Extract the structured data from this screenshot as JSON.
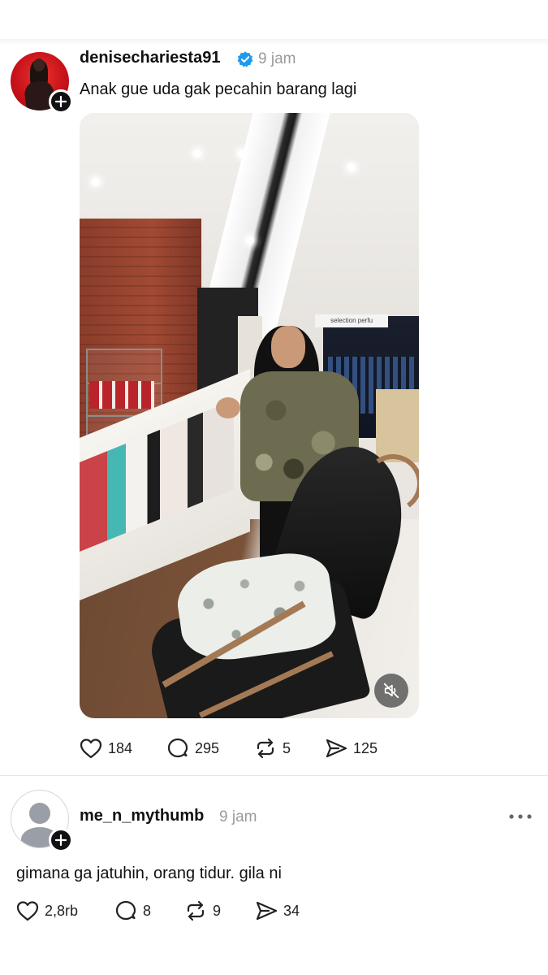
{
  "post": {
    "username": "denisechariesta91",
    "time": "9 jam",
    "text": "Anak gue uda gak pecahin barang lagi",
    "video_sign_text": "selection perfu",
    "actions": {
      "likes": "184",
      "comments": "295",
      "reposts": "5",
      "shares": "125"
    }
  },
  "comment": {
    "username": "me_n_mythumb",
    "time": "9 jam",
    "text": "gimana ga jatuhin, orang tidur. gila ni",
    "actions": {
      "likes": "2,8rb",
      "comments": "8",
      "reposts": "9",
      "shares": "34"
    }
  },
  "icons": {
    "verified": "verified-badge-icon",
    "follow": "plus-icon",
    "like": "heart-icon",
    "comment": "comment-bubble-icon",
    "repost": "repost-icon",
    "share": "send-icon",
    "mute": "speaker-muted-icon",
    "more": "more-horizontal-icon"
  },
  "colors": {
    "verified_blue": "#1d9bf0",
    "text_primary": "#111111",
    "text_secondary": "#9a9a9a"
  }
}
